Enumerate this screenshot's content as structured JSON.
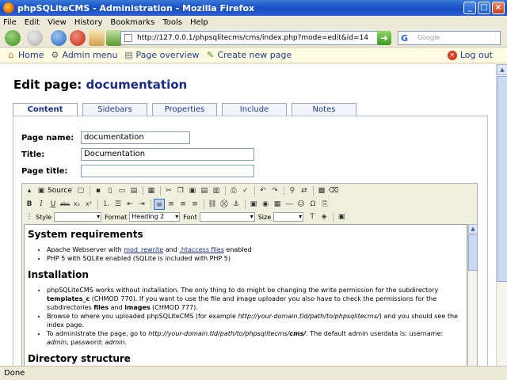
{
  "window": {
    "title": "phpSQLiteCMS - Administration - Mozilla Firefox"
  },
  "menu": [
    "File",
    "Edit",
    "View",
    "History",
    "Bookmarks",
    "Tools",
    "Help"
  ],
  "nav": {
    "url": "http://127.0.0.1/phpsqlitecms/cms/index.php?mode=edit&id=14",
    "search_placeholder": "Google",
    "search_logo": "G"
  },
  "admin": {
    "home": "Home",
    "admin_menu": "Admin menu",
    "page_overview": "Page overview",
    "create_page": "Create new page",
    "logout": "Log out"
  },
  "page": {
    "heading_prefix": "Edit page:",
    "heading_name": "documentation",
    "tabs": [
      "Content",
      "Sidebars",
      "Properties",
      "Include",
      "Notes"
    ],
    "fields": {
      "page_name_label": "Page name:",
      "page_name_value": "documentation",
      "title_label": "Title:",
      "title_value": "Documentation",
      "page_title_label": "Page title:",
      "page_title_value": ""
    }
  },
  "editor": {
    "source_label": "Source",
    "style_label": "Style",
    "format_label": "Format",
    "format_value": "Heading 2",
    "font_label": "Font",
    "size_label": "Size",
    "content": {
      "h1": "System requirements",
      "req1_pre": "Apache Webserver with ",
      "req1_link1": "mod_rewrite",
      "req1_mid": " and ",
      "req1_link2": ".htaccess files",
      "req1_post": " enabled",
      "req2": "PHP 5 with SQLite enabled (SQLite is included with PHP 5)",
      "h2": "Installation",
      "inst1_pre": "phpSQLiteCMS works without installation. The only thing to do might be changing the write permission for the subdirectory ",
      "inst1_b1": "templates_c",
      "inst1_mid": " (CHMOD 770). If you want to use the file and image uploader you also have to check the permissions for the subdirectories ",
      "inst1_b2": "files",
      "inst1_and": " and ",
      "inst1_b3": "images",
      "inst1_post": " (CHMOD 777).",
      "inst2_pre": "Browse to where you uploaded phpSQLiteCMS (for example ",
      "inst2_it": "http://your-domain.tld/path/to/phpsqlitecms/",
      "inst2_post": ") and you should see the index page.",
      "inst3_pre": "To administrate the page, go to ",
      "inst3_it": "http://your-domain.tld/path/to/phpsqlitecms/",
      "inst3_b": "cms/",
      "inst3_mid": ". The default admin userdata is: username: ",
      "inst3_u": "admin",
      "inst3_mid2": ", password: ",
      "inst3_p": "admin",
      "inst3_end": ".",
      "h3": "Directory structure"
    }
  },
  "status": "Done"
}
